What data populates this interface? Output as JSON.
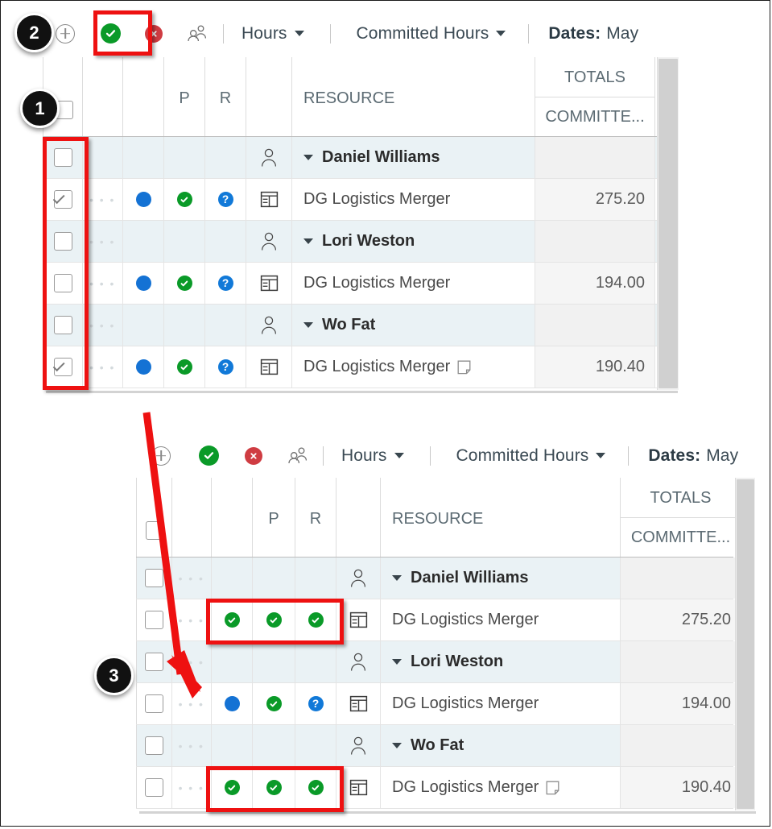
{
  "meta": {
    "accent_red": "#ee1111",
    "green": "#0a9a28",
    "blue": "#1472d4",
    "info_blue": "#1179d8",
    "red": "#cf3c42",
    "group_row_bg": "#eaf2f5"
  },
  "annotations": {
    "badges": [
      {
        "id": "badge-1",
        "label": "1"
      },
      {
        "id": "badge-2",
        "label": "2"
      },
      {
        "id": "badge-3",
        "label": "3"
      }
    ]
  },
  "toolbar": {
    "add_icon": "plus-circle-icon",
    "approve_icon": "approve-check-icon",
    "reject_icon": "reject-x-icon",
    "delegate_icon": "delegate-people-icon",
    "hours_label": "Hours",
    "committed_hours_label": "Committed Hours",
    "dates_label": "Dates:",
    "dates_value": "May"
  },
  "grid": {
    "columns": [
      {
        "key": "select",
        "label": ""
      },
      {
        "key": "actions",
        "label": ""
      },
      {
        "key": "status",
        "label": ""
      },
      {
        "key": "p",
        "label": "P"
      },
      {
        "key": "r",
        "label": "R"
      },
      {
        "key": "type",
        "label": ""
      },
      {
        "key": "resource",
        "label": "RESOURCE"
      }
    ],
    "totals_group": "TOTALS",
    "totals_sub": "COMMITTE..."
  },
  "top_panel": {
    "rows": [
      {
        "kind": "group",
        "checked": false,
        "dots": false,
        "status": null,
        "p": null,
        "r": null,
        "type_icon": "person-icon",
        "expander": true,
        "name": "Daniel Williams",
        "note_icon": false,
        "total": ""
      },
      {
        "kind": "item",
        "checked": true,
        "dots": true,
        "status": "blue-dot",
        "p": "green-check",
        "r": "blue-question",
        "type_icon": "task-icon",
        "expander": false,
        "name": "DG Logistics Merger",
        "note_icon": false,
        "total": "275.20"
      },
      {
        "kind": "group",
        "checked": false,
        "dots": true,
        "status": null,
        "p": null,
        "r": null,
        "type_icon": "person-icon",
        "expander": true,
        "name": "Lori Weston",
        "note_icon": false,
        "total": ""
      },
      {
        "kind": "item",
        "checked": false,
        "dots": true,
        "status": "blue-dot",
        "p": "green-check",
        "r": "blue-question",
        "type_icon": "task-icon",
        "expander": false,
        "name": "DG Logistics Merger",
        "note_icon": false,
        "total": "194.00"
      },
      {
        "kind": "group",
        "checked": false,
        "dots": true,
        "status": null,
        "p": null,
        "r": null,
        "type_icon": "person-icon",
        "expander": true,
        "name": "Wo Fat",
        "note_icon": false,
        "total": ""
      },
      {
        "kind": "item",
        "checked": true,
        "dots": true,
        "status": "blue-dot",
        "p": "green-check",
        "r": "blue-question",
        "type_icon": "task-icon",
        "expander": false,
        "name": "DG Logistics Merger",
        "note_icon": true,
        "total": "190.40"
      }
    ]
  },
  "bottom_panel": {
    "rows": [
      {
        "kind": "group",
        "checked": false,
        "dots": true,
        "status": null,
        "p": null,
        "r": null,
        "type_icon": "person-icon",
        "expander": true,
        "name": "Daniel Williams",
        "note_icon": false,
        "total": ""
      },
      {
        "kind": "item",
        "checked": false,
        "dots": true,
        "status": "green-check",
        "p": "green-check",
        "r": "green-check",
        "type_icon": "task-icon",
        "expander": false,
        "name": "DG Logistics Merger",
        "note_icon": false,
        "total": "275.20"
      },
      {
        "kind": "group",
        "checked": false,
        "dots": true,
        "status": null,
        "p": null,
        "r": null,
        "type_icon": "person-icon",
        "expander": true,
        "name": "Lori Weston",
        "note_icon": false,
        "total": ""
      },
      {
        "kind": "item",
        "checked": false,
        "dots": true,
        "status": "blue-dot",
        "p": "green-check",
        "r": "blue-question",
        "type_icon": "task-icon",
        "expander": false,
        "name": "DG Logistics Merger",
        "note_icon": false,
        "total": "194.00"
      },
      {
        "kind": "group",
        "checked": false,
        "dots": true,
        "status": null,
        "p": null,
        "r": null,
        "type_icon": "person-icon",
        "expander": true,
        "name": "Wo Fat",
        "note_icon": false,
        "total": ""
      },
      {
        "kind": "item",
        "checked": false,
        "dots": true,
        "status": "green-check",
        "p": "green-check",
        "r": "green-check",
        "type_icon": "task-icon",
        "expander": false,
        "name": "DG Logistics Merger",
        "note_icon": true,
        "total": "190.40"
      }
    ]
  }
}
